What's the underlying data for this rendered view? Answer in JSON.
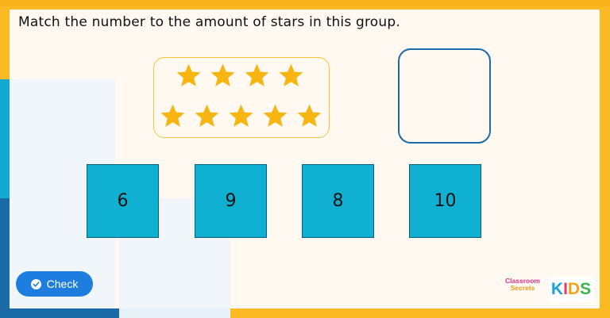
{
  "question": {
    "text": "Match the number to the amount of stars in this group."
  },
  "star_group": {
    "count": 9,
    "row1_count": 4,
    "row2_count": 5,
    "star_color": "#f7b512",
    "border_color": "#f5c33b"
  },
  "answer_box": {
    "value": "",
    "border_color": "#1e6aa8"
  },
  "options": [
    {
      "label": "6"
    },
    {
      "label": "9"
    },
    {
      "label": "8"
    },
    {
      "label": "10"
    }
  ],
  "check_button": {
    "label": "Check",
    "icon": "check-circle-icon",
    "color": "#1e7ee0"
  },
  "branding": {
    "line1": "Classroom",
    "line2": "Secrets",
    "kids_letters": [
      "K",
      "I",
      "D",
      "S"
    ],
    "kids_colors": [
      "#1aa0dc",
      "#e83a6d",
      "#f6a21b",
      "#39b54a"
    ]
  },
  "colors": {
    "frame": "#fbb923",
    "panel": "#fff9f1",
    "card": "#0fb0d2"
  }
}
